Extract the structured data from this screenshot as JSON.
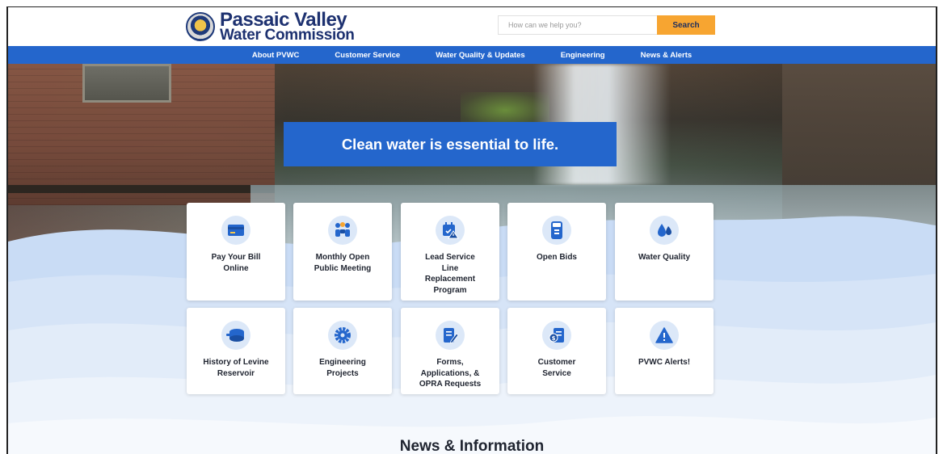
{
  "header": {
    "logo_line1": "Passaic Valley",
    "logo_line2": "Water Commission",
    "search_placeholder": "How can we help you?",
    "search_button": "Search"
  },
  "nav": {
    "items": [
      {
        "label": "About PVWC"
      },
      {
        "label": "Customer Service"
      },
      {
        "label": "Water Quality & Updates"
      },
      {
        "label": "Engineering"
      },
      {
        "label": "News & Alerts"
      }
    ]
  },
  "hero": {
    "tagline": "Clean water is essential to life."
  },
  "cards": [
    {
      "label": "Pay Your Bill\nOnline",
      "icon": "credit-card-icon"
    },
    {
      "label": "Monthly Open\nPublic Meeting",
      "icon": "meeting-icon"
    },
    {
      "label": "Lead Service\nLine\nReplacement\nProgram",
      "icon": "calendar-alert-icon"
    },
    {
      "label": "Open Bids",
      "icon": "bid-icon"
    },
    {
      "label": "Water Quality",
      "icon": "water-drops-icon"
    },
    {
      "label": "History of Levine\nReservoir",
      "icon": "reservoir-icon"
    },
    {
      "label": "Engineering\nProjects",
      "icon": "gear-icon"
    },
    {
      "label": "Forms,\nApplications, &\nOPRA Requests",
      "icon": "form-edit-icon"
    },
    {
      "label": "Customer\nService",
      "icon": "invoice-icon"
    },
    {
      "label": "PVWC Alerts!",
      "icon": "alert-icon"
    }
  ],
  "news": {
    "heading": "News & Information"
  },
  "colors": {
    "brand_blue": "#2466cc",
    "search_orange": "#f7a531",
    "logo_navy": "#1d3170",
    "icon_bg": "#dce8f8"
  }
}
